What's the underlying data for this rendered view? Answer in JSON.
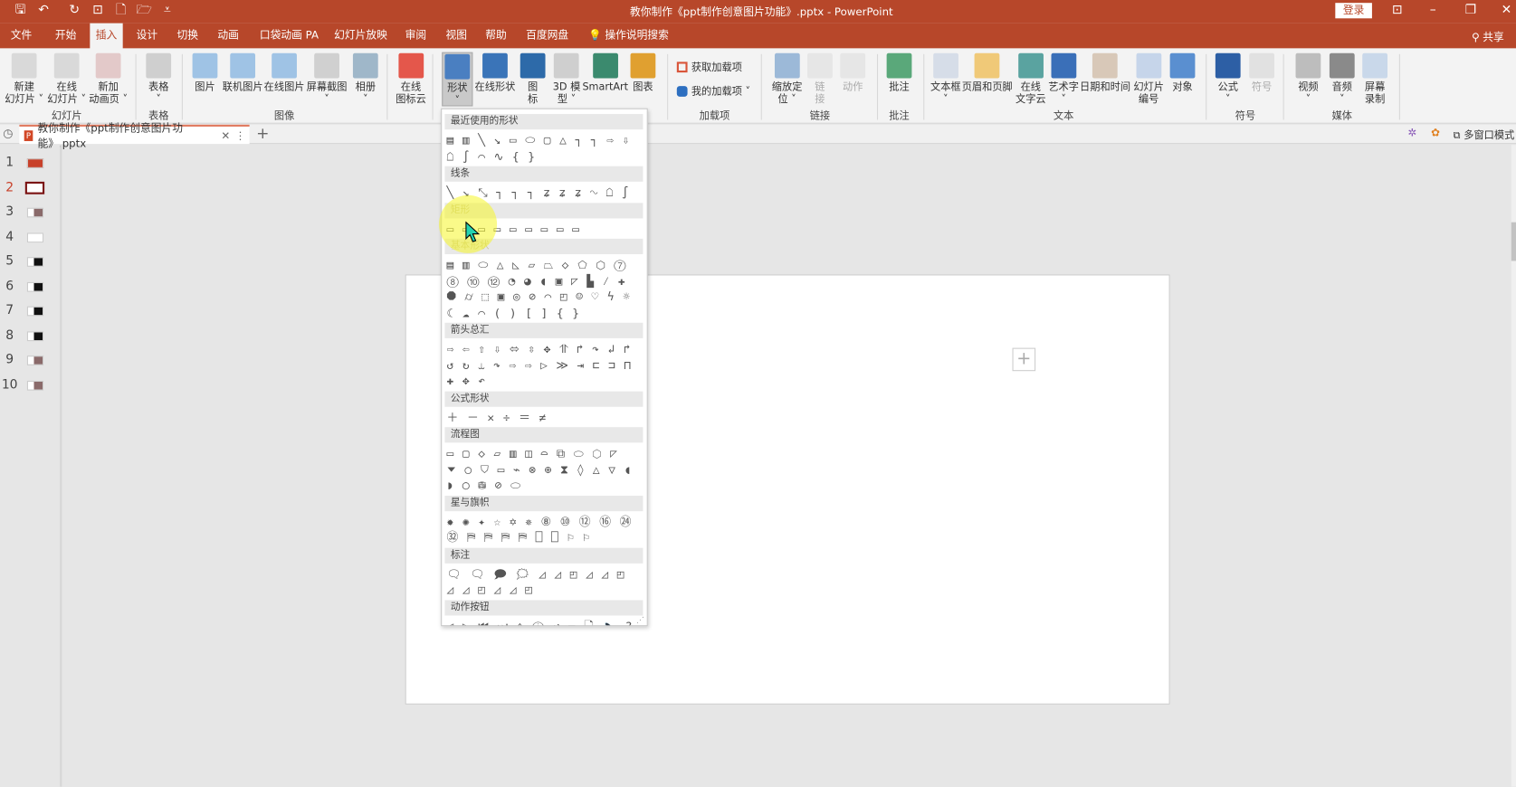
{
  "colors": {
    "brand": "#b7472a",
    "ribbon_bg": "#f3f3f3",
    "workspace": "#e6e6e6",
    "selected_thumb": "#7a1212",
    "highlight": "#f5f53c"
  },
  "titlebar": {
    "title": "教你制作《ppt制作创意图片功能》.pptx  -  PowerPoint",
    "login": "登录",
    "quick_access": [
      {
        "icon": "save-icon",
        "glyph": "🖫"
      },
      {
        "icon": "undo-icon",
        "glyph": "↶"
      },
      {
        "icon": "redo-icon",
        "glyph": "↻"
      },
      {
        "icon": "present-icon",
        "glyph": "⊡"
      },
      {
        "icon": "new-icon",
        "glyph": "🗋"
      },
      {
        "icon": "open-icon",
        "glyph": "🗁"
      },
      {
        "icon": "customize-icon",
        "glyph": "⩡"
      }
    ],
    "window_controls": [
      {
        "icon": "ribbon-display-icon",
        "glyph": "⊡"
      },
      {
        "icon": "minimize-icon",
        "glyph": "–"
      },
      {
        "icon": "restore-icon",
        "glyph": "❐"
      },
      {
        "icon": "close-icon",
        "glyph": "✕"
      }
    ]
  },
  "tabs": [
    {
      "label": "文件"
    },
    {
      "label": "开始"
    },
    {
      "label": "插入",
      "active": true
    },
    {
      "label": "设计"
    },
    {
      "label": "切换"
    },
    {
      "label": "动画"
    },
    {
      "label": "口袋动画 PA"
    },
    {
      "label": "幻灯片放映"
    },
    {
      "label": "审阅"
    },
    {
      "label": "视图"
    },
    {
      "label": "帮助"
    },
    {
      "label": "百度网盘"
    },
    {
      "label": "💡 操作说明搜索"
    }
  ],
  "share": "共享",
  "ribbon": {
    "buttons": [
      {
        "label": "新建\n幻灯片 ˅",
        "color": "#d9d9d9"
      },
      {
        "label": "在线\n幻灯片 ˅",
        "color": "#d9d9d9"
      },
      {
        "label": "新加\n动画页 ˅",
        "color": "#e3c9c9"
      },
      {
        "label": "表格\n˅",
        "color": "#cfcfcf"
      },
      {
        "label": "图片",
        "color": "#9fc3e5"
      },
      {
        "label": "联机图片",
        "color": "#9fc3e5"
      },
      {
        "label": "在线图片",
        "color": "#9fc3e5"
      },
      {
        "label": "屏幕截图\n˅",
        "color": "#d0d0d0"
      },
      {
        "label": "相册\n˅",
        "color": "#9fb7c9"
      },
      {
        "label": "在线\n图标云",
        "color": "#e4574b"
      },
      {
        "label": "形状\n˅",
        "color": "#4a7fc1",
        "selected": true
      },
      {
        "label": "在线形状",
        "color": "#3a74b8"
      },
      {
        "label": "图\n标",
        "color": "#2d6aa9"
      },
      {
        "label": "3D 模\n型 ˅",
        "color": "#cfcfcf"
      },
      {
        "label": "SmartArt",
        "color": "#3b8a6e"
      },
      {
        "label": "图表",
        "color": "#e0a030"
      },
      {
        "label": "缩放定\n位 ˅",
        "color": "#9cb9d8"
      },
      {
        "label": "链\n接",
        "color": "#d9d9d9",
        "disabled": true
      },
      {
        "label": "动作",
        "color": "#d9d9d9",
        "disabled": true
      },
      {
        "label": "批注",
        "color": "#5aa87a"
      },
      {
        "label": "文本框\n˅",
        "color": "#d6dde8"
      },
      {
        "label": "页眉和页脚",
        "color": "#f0c978"
      },
      {
        "label": "在线\n文字云",
        "color": "#5aa3a0"
      },
      {
        "label": "艺术字\n˅",
        "color": "#3a6fb8"
      },
      {
        "label": "日期和时间",
        "color": "#d8c8b8"
      },
      {
        "label": "幻灯片\n编号",
        "color": "#c6d5ea"
      },
      {
        "label": "对象",
        "color": "#5a8fd0"
      },
      {
        "label": "公式\n˅",
        "color": "#2d5fa5"
      },
      {
        "label": "符号",
        "color": "#cfcfcf",
        "disabled": true
      },
      {
        "label": "视频\n˅",
        "color": "#bdbdbd"
      },
      {
        "label": "音频\n˅",
        "color": "#8a8a8a"
      },
      {
        "label": "屏幕\n录制",
        "color": "#c9d8ea"
      }
    ],
    "addins": {
      "get": "获取加载项",
      "mine": "我的加载项 ˅"
    },
    "groups": [
      "幻灯片",
      "表格",
      "图像",
      "加载项",
      "链接",
      "批注",
      "文本",
      "符号",
      "媒体"
    ]
  },
  "document_tab": {
    "name": "教你制作《ppt制作创意图片功能》.pptx",
    "close": "✕",
    "more": "⋮",
    "add": "+",
    "multiwindow": "多窗口模式"
  },
  "slides": [
    {
      "num": "1",
      "thumb": "#c8412a"
    },
    {
      "num": "2",
      "thumb": "#ffffff",
      "selected": true
    },
    {
      "num": "3",
      "thumb": "#8a6a6a"
    },
    {
      "num": "4",
      "thumb": "#ffffff"
    },
    {
      "num": "5",
      "thumb": "#111111"
    },
    {
      "num": "6",
      "thumb": "#111111"
    },
    {
      "num": "7",
      "thumb": "#111111"
    },
    {
      "num": "8",
      "thumb": "#111111"
    },
    {
      "num": "9",
      "thumb": "#8a6a6a"
    },
    {
      "num": "10",
      "thumb": "#8a6a6a"
    }
  ],
  "slide_placeholder": "+",
  "shapes_menu": {
    "sections": [
      {
        "title": "最近使用的形状",
        "glyphs": "▤▥╲↘▭⬭▢△┐┐⇨⇩☖∫⌒∿{}"
      },
      {
        "title": "线条",
        "glyphs": "╲↘⤡┐┐┐ʑʑʑ∿☖∫"
      },
      {
        "title": "矩形",
        "glyphs": "▭▭▭▭▭▭▭▭▭",
        "dim": true
      },
      {
        "title": "基本形状",
        "glyphs": "▤▥⬭△◺▱⏢◇⬠⬡⑦⑧⑩⑫◔◕◖▣◸▙⁄✚⯃⌭⬚▣◎⊘⌒◰☺♡ϟ☼☾☁⌒()[]{}",
        "dim": true
      },
      {
        "title": "箭头总汇",
        "glyphs": "⇨⇦⇧⇩⬄⇳✥⥣↱↷↲↱↺↻⥿↷⇨⇨▷≫⇥⊏⊐⊓✚✥↶"
      },
      {
        "title": "公式形状",
        "glyphs": "＋－✕÷＝≠"
      },
      {
        "title": "流程图",
        "glyphs": "▭▢◇▱▥◫⌓⧉⬭⬡◸⏷○⛉▭⌁⊗⊕⧗◊△▽◖◗◯⛁⊘⬭"
      },
      {
        "title": "星与旗帜",
        "glyphs": "✹✺✦☆✡✵⑧⑩⑫⑯㉔㉜⛿⛿⛿⛿⎕⎕⚐⚐"
      },
      {
        "title": "标注",
        "glyphs": "🗨🗨🗩🗯◿◿◰◿◿◰◿◿◰◿◿◰"
      },
      {
        "title": "动作按钮",
        "glyphs": "◁▷⏮⏭⌂ⓘ↩▭🗋🔈?□"
      }
    ]
  }
}
